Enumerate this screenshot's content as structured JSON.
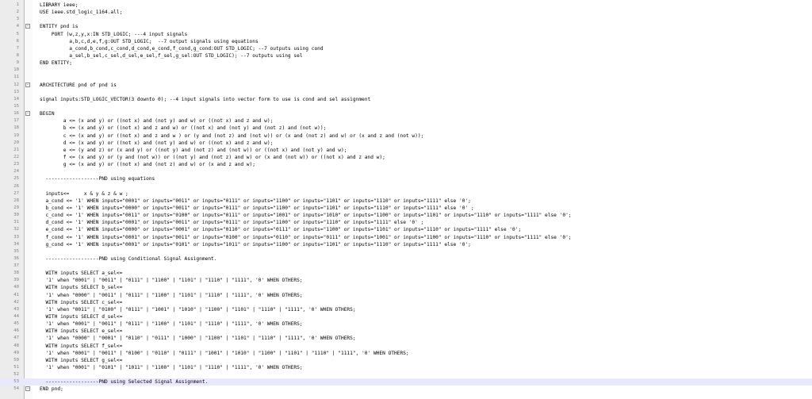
{
  "editor": {
    "lines": [
      {
        "n": "1",
        "t": "LIBRARY ieee;"
      },
      {
        "n": "2",
        "t": "USE ieee.std_logic_1164.all;"
      },
      {
        "n": "3",
        "t": ""
      },
      {
        "n": "4",
        "t": "ENTITY pnd is",
        "fold": "-"
      },
      {
        "n": "5",
        "t": "    PORT (w,z,y,x:IN STD_LOGIC; ---4 input signals"
      },
      {
        "n": "6",
        "t": "          a,b,c,d,e,f,g:OUT STD_LOGIC;  --7 output signals using equations"
      },
      {
        "n": "7",
        "t": "          a_cond,b_cond,c_cond,d_cond,e_cond,f_cond,g_cond:OUT STD_LOGIC; --7 outputs using cond"
      },
      {
        "n": "8",
        "t": "          a_sel,b_sel,c_sel,d_sel,e_sel,f_sel,g_sel:OUT STD_LOGIC); --7 outputs using sel"
      },
      {
        "n": "9",
        "t": "END ENTITY;"
      },
      {
        "n": "10",
        "t": ""
      },
      {
        "n": "11",
        "t": ""
      },
      {
        "n": "12",
        "t": "ARCHITECTURE pnd of pnd is",
        "fold": "-"
      },
      {
        "n": "13",
        "t": ""
      },
      {
        "n": "14",
        "t": "signal inputs:STD_LOGIC_VECTOR(3 downto 0); --4 input signals into vector form to use is cond and sel assignment"
      },
      {
        "n": "15",
        "t": ""
      },
      {
        "n": "16",
        "t": "BEGIN",
        "fold": "-"
      },
      {
        "n": "17",
        "t": "        a <= (x and y) or ((not x) and (not y) and w) or ((not x) and z and w);"
      },
      {
        "n": "18",
        "t": "        b <= (x and y) or ((not x) and z and w) or ((not x) and (not y) and (not z) and (not w));"
      },
      {
        "n": "19",
        "t": "        c <= (x and y) or ((not x) and z and w ) or (y and (not z) and (not w)) or (x and (not z) and w) or (x and z and (not w));"
      },
      {
        "n": "20",
        "t": "        d <= (x and y) or ((not x) and (not y) and w) or ((not x) and z and w);"
      },
      {
        "n": "21",
        "t": "        e <= (y and z) or (x and y) or ((not y) and (not z) and (not w)) or ((not x) and (not y) and w);"
      },
      {
        "n": "22",
        "t": "        f <= (x and y) or (y and (not w)) or ((not y) and (not z) and w) or (x and (not w)) or ((not x) and z and w);"
      },
      {
        "n": "23",
        "t": "        g <= (x and y) or ((not x) and (not z) and w) or (x and z and w);"
      },
      {
        "n": "24",
        "t": ""
      },
      {
        "n": "25",
        "t": "  ------------------PND using equations"
      },
      {
        "n": "26",
        "t": ""
      },
      {
        "n": "27",
        "t": "  inputs<=     x & y & z & w ;"
      },
      {
        "n": "28",
        "t": "  a_cond <= '1' WHEN inputs=\"0001\" or inputs=\"0011\" or inputs=\"0111\" or inputs=\"1100\" or inputs=\"1101\" or inputs=\"1110\" or inputs=\"1111\" else '0';"
      },
      {
        "n": "29",
        "t": "  b_cond <= '1' WHEN inputs=\"0000\" or inputs=\"0011\" or inputs=\"0111\" or inputs=\"1100\" or inputs=\"1101\" or inputs=\"1110\" or inputs=\"1111\" else '0' ;"
      },
      {
        "n": "30",
        "t": "  c_cond <= '1' WHEN inputs=\"0011\" or inputs=\"0100\" or inputs=\"0111\" or inputs=\"1001\" or inputs=\"1010\" or inputs=\"1100\" or inputs=\"1101\" or inputs=\"1110\" or inputs=\"1111\" else '0';"
      },
      {
        "n": "31",
        "t": "  d_cond <= '1' WHEN inputs=\"0001\" or inputs=\"0011\" or inputs=\"0111\" or inputs=\"1100\" or inputs=\"1110\" or inputs=\"1111\" else '0' ;"
      },
      {
        "n": "32",
        "t": "  e_cond <= '1' WHEN inputs=\"0000\" or inputs=\"0001\" or inputs=\"0110\" or inputs=\"0111\" or inputs=\"1100\" or inputs=\"1101\" or inputs=\"1110\" or inputs=\"1111\" else '0';"
      },
      {
        "n": "33",
        "t": "  f_cond <= '1' WHEN inputs=\"0001\" or inputs=\"0011\" or inputs=\"0100\" or inputs=\"0110\" or inputs=\"0111\" or inputs=\"1001\" or inputs=\"1100\" or inputs=\"1110\" or inputs=\"1111\" else '0';"
      },
      {
        "n": "34",
        "t": "  g_cond <= '1' WHEN inputs=\"0001\" or inputs=\"0101\" or inputs=\"1011\" or inputs=\"1100\" or inputs=\"1101\" or inputs=\"1110\" or inputs=\"1111\" else '0';"
      },
      {
        "n": "35",
        "t": ""
      },
      {
        "n": "36",
        "t": "  ------------------PND using Conditional Signal Assignment."
      },
      {
        "n": "37",
        "t": ""
      },
      {
        "n": "38",
        "t": "  WITH inputs SELECT a_sel<="
      },
      {
        "n": "39",
        "t": "  '1' when \"0001\" | \"0011\" | \"0111\" | \"1100\" | \"1101\" | \"1110\" | \"1111\", '0' WHEN OTHERS;"
      },
      {
        "n": "40",
        "t": "  WITH inputs SELECT b_sel<="
      },
      {
        "n": "41",
        "t": "  '1' when \"0000\" | \"0011\" | \"0111\" | \"1100\" | \"1101\" | \"1110\" | \"1111\", '0' WHEN OTHERS;"
      },
      {
        "n": "42",
        "t": "  WITH inputs SELECT c_sel<="
      },
      {
        "n": "43",
        "t": "  '1' when \"0011\" | \"0100\" | \"0111\" | \"1001\" | \"1010\" | \"1100\" | \"1101\" | \"1110\" | \"1111\", '0' WHEN OTHERS;"
      },
      {
        "n": "44",
        "t": "  WITH inputs SELECT d_sel<="
      },
      {
        "n": "45",
        "t": "  '1' when \"0001\" | \"0011\" | \"0111\" | \"1100\" | \"1101\" | \"1110\" | \"1111\", '0' WHEN OTHERS;"
      },
      {
        "n": "46",
        "t": "  WITH inputs SELECT e_sel<="
      },
      {
        "n": "47",
        "t": "  '1' when \"0000\" | \"0001\" | \"0110\" | \"0111\" | \"1000\" | \"1100\" | \"1101\" | \"1110\" | \"1111\", '0' WHEN OTHERS;"
      },
      {
        "n": "48",
        "t": "  WITH inputs SELECT f_sel<="
      },
      {
        "n": "49",
        "t": "  '1' when \"0001\" | \"0011\" | \"0100\" | \"0110\" | \"0111\" | \"1001\" | \"1010\" | \"1100\" | \"1101\" | \"1110\" | \"1111\", '0' WHEN OTHERS;"
      },
      {
        "n": "50",
        "t": "  WITH inputs SELECT g_sel<="
      },
      {
        "n": "51",
        "t": "  '1' when \"0001\" | \"0101\" | \"1011\" | \"1100\" | \"1101\" | \"1110\" | \"1111\", '0' WHEN OTHERS;"
      },
      {
        "n": "52",
        "t": ""
      },
      {
        "n": "53",
        "t": "  ------------------PND using Selected Signal Assignment.",
        "current": true
      },
      {
        "n": "54",
        "t": "END pnd;",
        "fold": "-"
      }
    ]
  }
}
